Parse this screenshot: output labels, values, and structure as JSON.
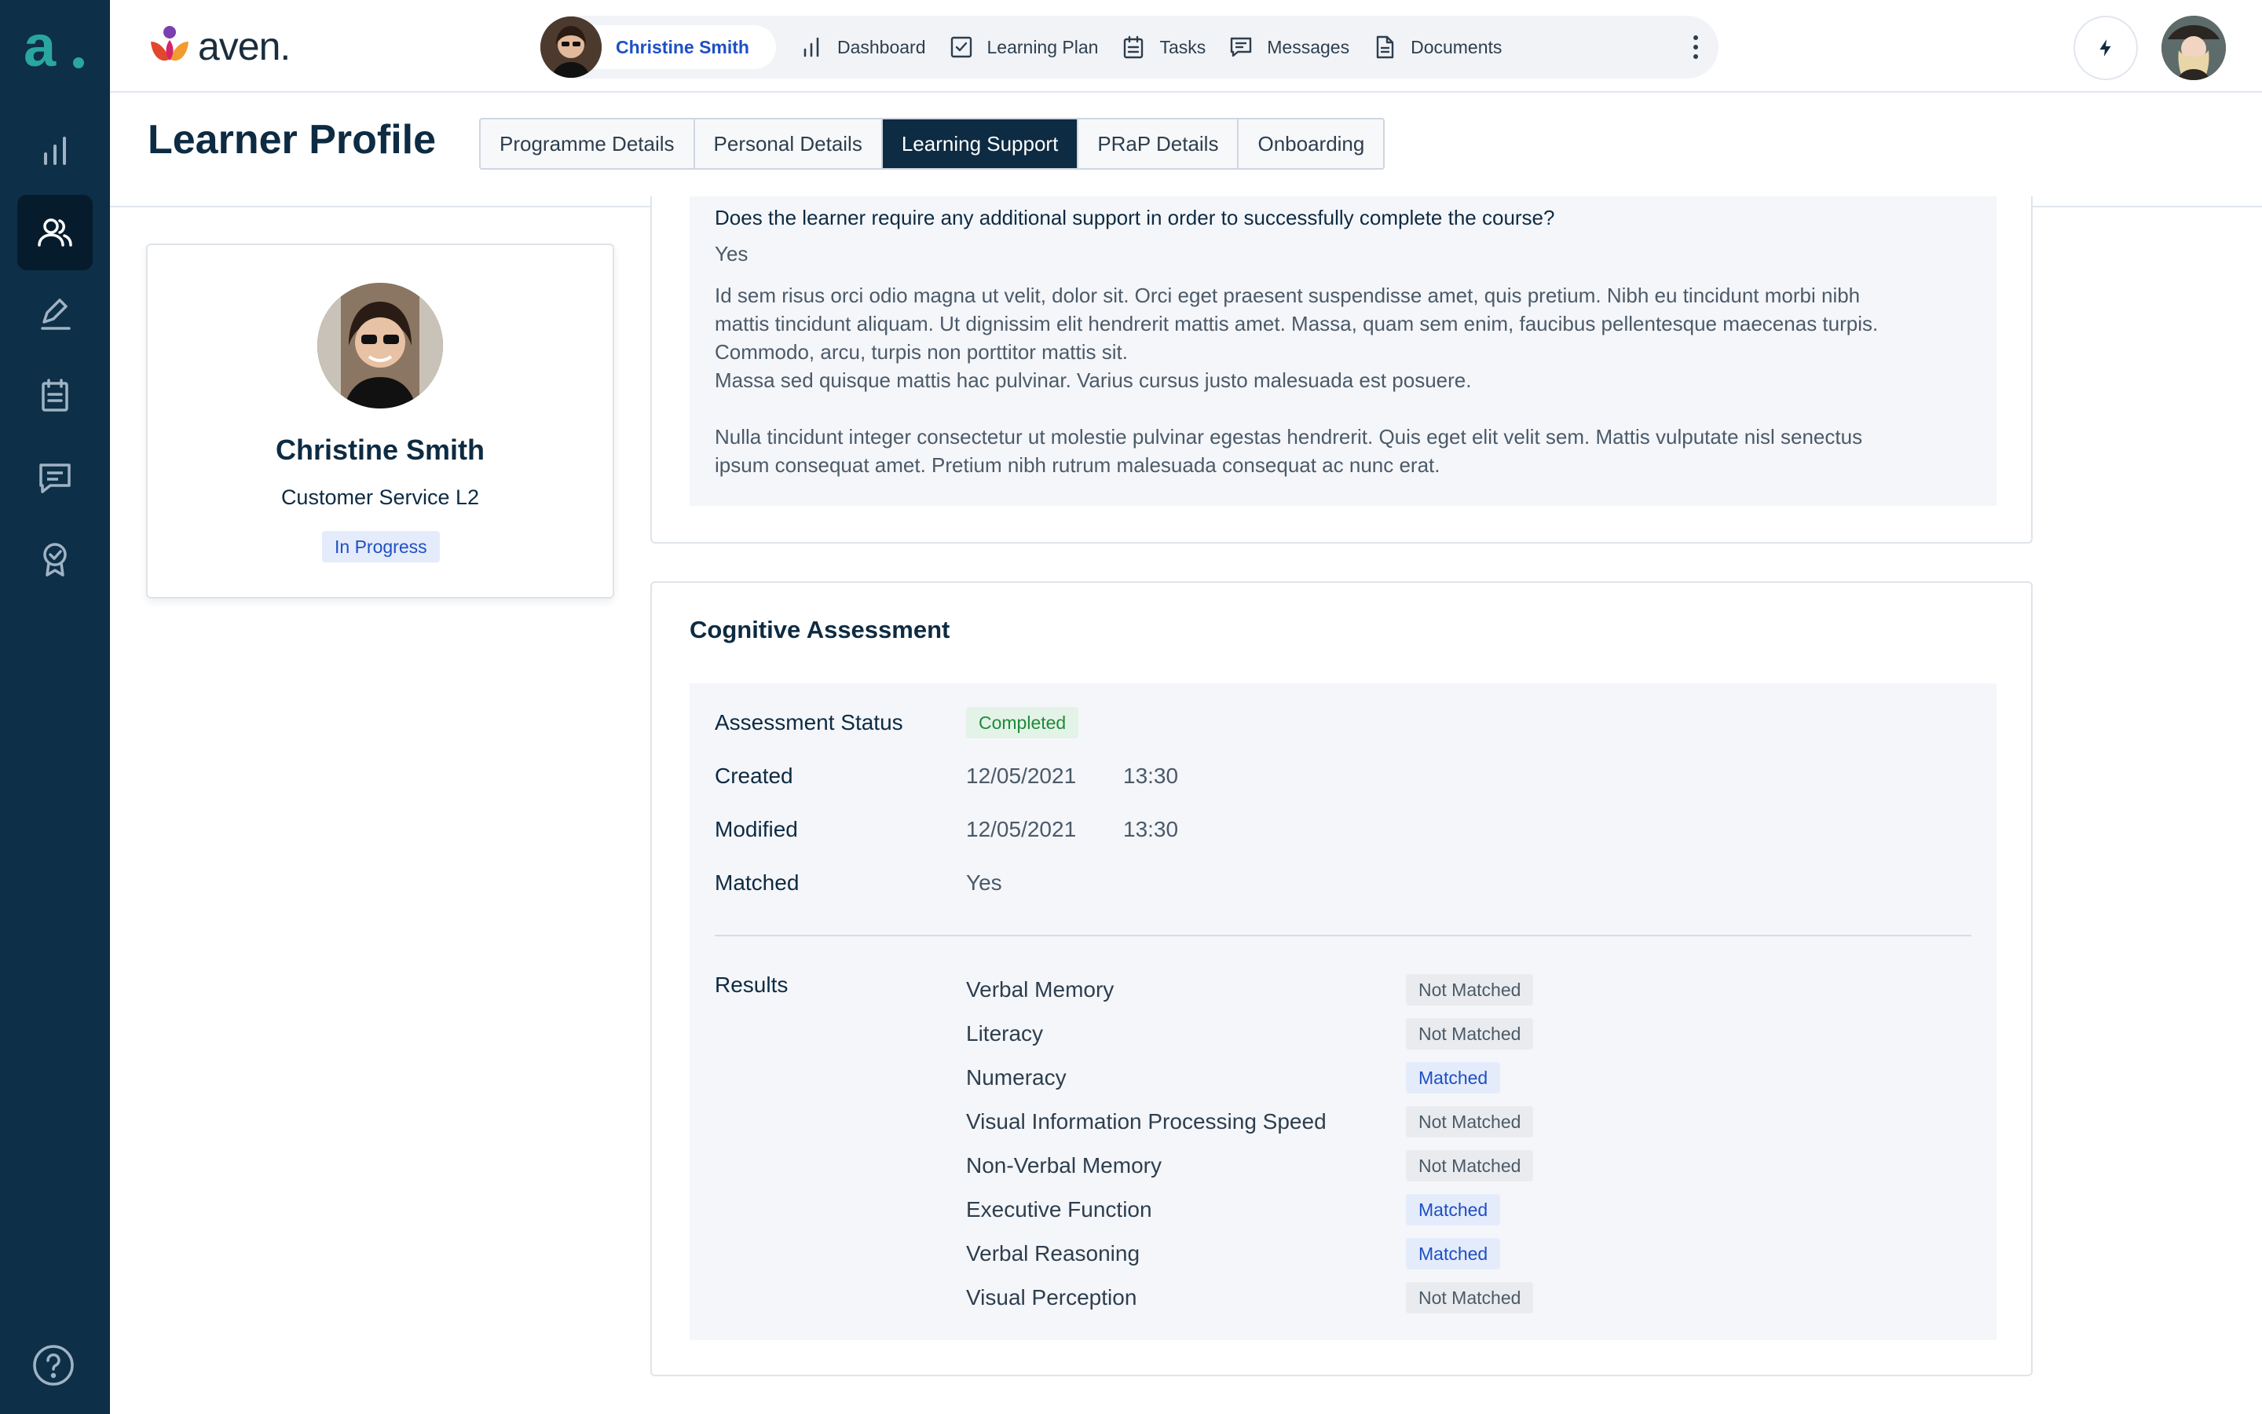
{
  "brand": {
    "name": "aven.",
    "rail_logo": "a."
  },
  "nav": {
    "user_name": "Christine Smith",
    "items": [
      {
        "label": "Dashboard",
        "icon": "bar-chart-icon"
      },
      {
        "label": "Learning Plan",
        "icon": "checkbox-icon"
      },
      {
        "label": "Tasks",
        "icon": "clipboard-icon"
      },
      {
        "label": "Messages",
        "icon": "chat-icon"
      },
      {
        "label": "Documents",
        "icon": "document-icon"
      }
    ]
  },
  "page": {
    "title": "Learner Profile",
    "tabs": [
      "Programme Details",
      "Personal Details",
      "Learning Support",
      "PRaP Details",
      "Onboarding"
    ],
    "active_tab": "Learning Support"
  },
  "profile": {
    "name": "Christine Smith",
    "role": "Customer Service L2",
    "status": "In Progress"
  },
  "support": {
    "question": "Does the learner require any additional support in order to successfully complete the course?",
    "answer": "Yes",
    "para1_l1": "Id sem risus orci odio magna ut velit, dolor sit. Orci eget praesent suspendisse amet, quis pretium. Nibh eu tincidunt morbi nibh",
    "para1_l2": "mattis tincidunt aliquam. Ut dignissim elit hendrerit mattis amet. Massa, quam sem enim, faucibus pellentesque maecenas turpis.",
    "para1_l3": "Commodo, arcu, turpis non porttitor mattis sit.",
    "para1_l4": "Massa sed quisque mattis hac pulvinar. Varius cursus justo malesuada est posuere.",
    "para2_l1": "Nulla tincidunt integer consectetur ut molestie pulvinar egestas hendrerit. Quis eget elit velit sem. Mattis vulputate nisl senectus",
    "para2_l2": "ipsum consequat amet. Pretium nibh rutrum malesuada consequat ac nunc erat."
  },
  "assessment": {
    "title": "Cognitive Assessment",
    "status_label": "Assessment Status",
    "status": "Completed",
    "created_label": "Created",
    "created_date": "12/05/2021",
    "created_time": "13:30",
    "modified_label": "Modified",
    "modified_date": "12/05/2021",
    "modified_time": "13:30",
    "matched_label": "Matched",
    "matched": "Yes",
    "results_label": "Results",
    "results": [
      {
        "name": "Verbal Memory",
        "status": "Not Matched"
      },
      {
        "name": "Literacy",
        "status": "Not Matched"
      },
      {
        "name": "Numeracy",
        "status": "Matched"
      },
      {
        "name": "Visual Information Processing Speed",
        "status": "Not Matched"
      },
      {
        "name": "Non-Verbal Memory",
        "status": "Not Matched"
      },
      {
        "name": "Executive Function",
        "status": "Matched"
      },
      {
        "name": "Verbal Reasoning",
        "status": "Matched"
      },
      {
        "name": "Visual Perception",
        "status": "Not Matched"
      }
    ]
  },
  "colors": {
    "sidebar": "#0d2f47",
    "primary": "#0d2b42",
    "link": "#1e4fc4",
    "success": "#1f8a3a",
    "brand_teal": "#2aa6a0"
  }
}
